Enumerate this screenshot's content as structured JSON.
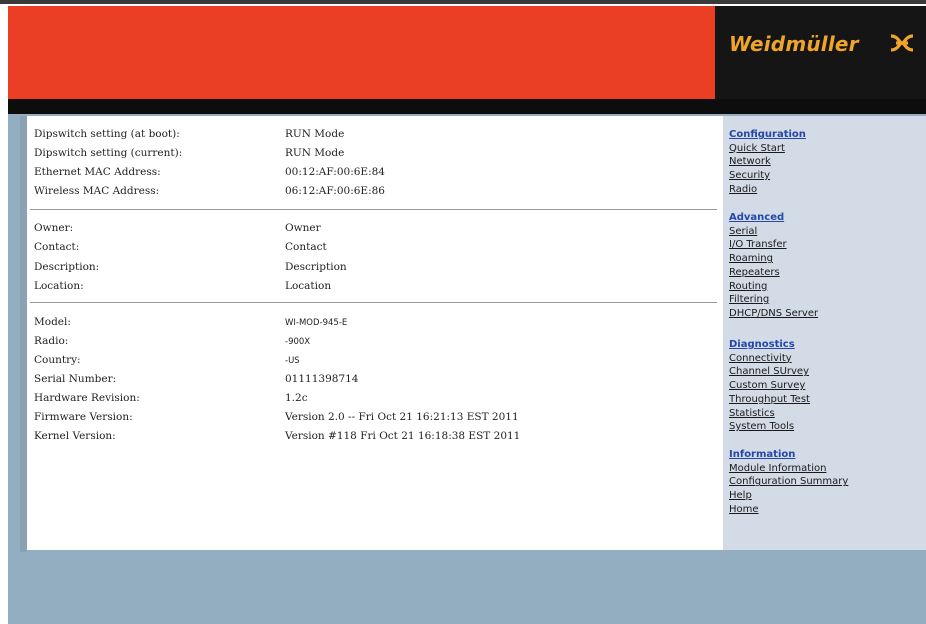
{
  "brand": {
    "logo_text": "Weidmüller"
  },
  "info_sections": [
    {
      "rows": [
        {
          "label": "Dipswitch setting (at boot):",
          "value": "RUN Mode"
        },
        {
          "label": "Dipswitch setting (current):",
          "value": "RUN Mode"
        },
        {
          "label": "Ethernet MAC Address:",
          "value": "00:12:AF:00:6E:84"
        },
        {
          "label": "Wireless MAC Address:",
          "value": "06:12:AF:00:6E:86"
        }
      ]
    },
    {
      "rows": [
        {
          "label": "Owner:",
          "value": "Owner"
        },
        {
          "label": "Contact:",
          "value": "Contact"
        },
        {
          "label": "Description:",
          "value": "Description"
        },
        {
          "label": "Location:",
          "value": "Location"
        }
      ]
    },
    {
      "rows": [
        {
          "label": "Model:",
          "value": "WI-MOD-945-E"
        },
        {
          "label": "Radio:",
          "value": "-900X"
        },
        {
          "label": "Country:",
          "value": "-US"
        },
        {
          "label": "Serial Number:",
          "value": "01111398714"
        },
        {
          "label": "Hardware Revision:",
          "value": "1.2c"
        },
        {
          "label": "Firmware Version:",
          "value": "Version 2.0 -- Fri Oct 21 16:21:13 EST 2011"
        },
        {
          "label": "Kernel Version:",
          "value": "Version #118 Fri Oct 21 16:18:38 EST 2011"
        }
      ]
    }
  ],
  "sidebar": {
    "groups": [
      {
        "heading": "Configuration",
        "links": [
          "Quick Start",
          "Network",
          "Security",
          "Radio"
        ]
      },
      {
        "heading": "Advanced",
        "links": [
          "Serial",
          "I/O Transfer",
          "Roaming",
          "Repeaters",
          "Routing",
          "Filtering",
          "DHCP/DNS Server"
        ]
      },
      {
        "heading": "Diagnostics",
        "links": [
          "Connectivity",
          "Channel SUrvey",
          "Custom Survey",
          "Throughput Test",
          "Statistics",
          "System Tools"
        ]
      },
      {
        "heading": "Information",
        "links": [
          "Module Information",
          "Configuration Summary",
          "Help",
          "Home"
        ]
      }
    ]
  }
}
